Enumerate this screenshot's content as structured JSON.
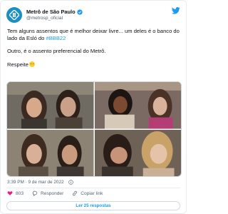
{
  "tweet": {
    "author": {
      "display_name": "Metrô de São Paulo",
      "handle": "@metrosp_oficial",
      "verified": true,
      "avatar_color": "#1a8fc0"
    },
    "text": {
      "line1": "Tem alguns assentos que é melhor deixar livre... um deles é o banco do lado da Esló do ",
      "hashtag": "#BBB22",
      "line2": "Outro, é o assento preferencial do Metrô.",
      "line3": "Respeite"
    },
    "media": [
      {
        "icon": "photo-woman-dark-hair"
      },
      {
        "icon": "photo-woman-laughing"
      },
      {
        "icon": "photo-woman-covering-mouth"
      },
      {
        "icon": "photo-woman-blonde"
      }
    ],
    "timestamp": "3:39 PM · 9 de mar de 2022",
    "actions": {
      "likes": "803",
      "reply_label": "Responder",
      "copy_label": "Copiar link"
    },
    "more_replies_label": "Ler 25 respostas"
  },
  "colors": {
    "accent": "#1d9bf0",
    "like": "#f91880",
    "muted": "#536471"
  }
}
